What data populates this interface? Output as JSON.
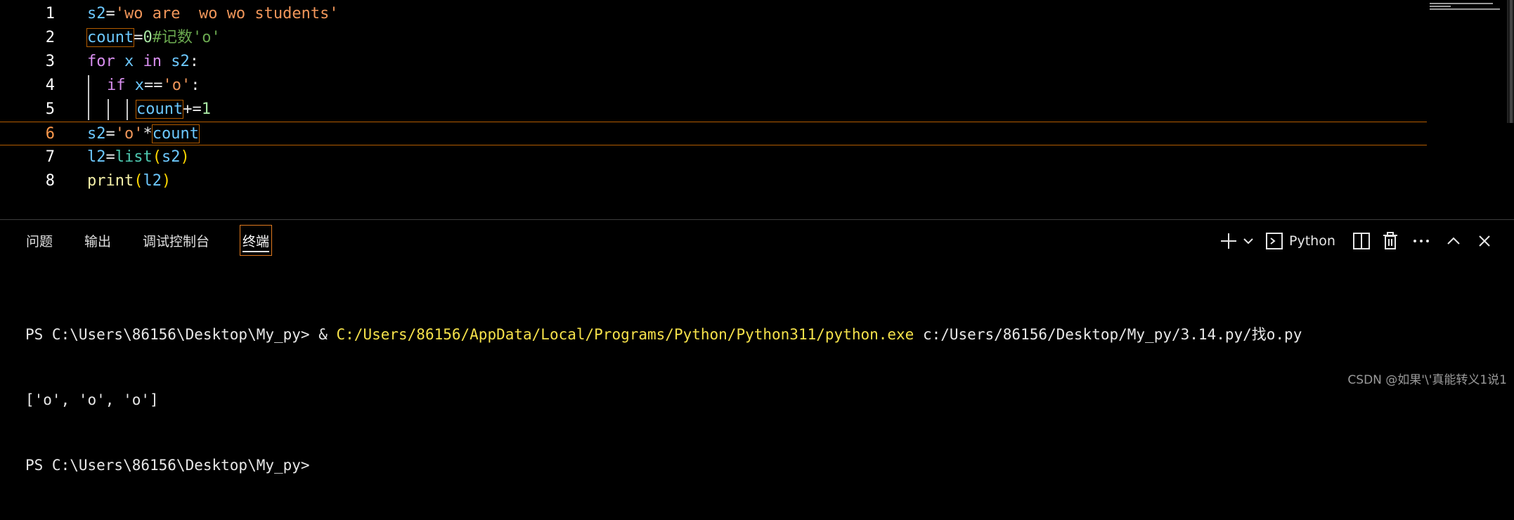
{
  "editor": {
    "lines": [
      {
        "number": "1"
      },
      {
        "number": "2"
      },
      {
        "number": "3"
      },
      {
        "number": "4"
      },
      {
        "number": "5"
      },
      {
        "number": "6"
      },
      {
        "number": "7"
      },
      {
        "number": "8"
      }
    ],
    "tokens": {
      "l1_a": "s2",
      "l1_b": "=",
      "l1_c": "'wo are  wo wo students'",
      "l2_a": "count",
      "l2_b": "=",
      "l2_c": "0",
      "l2_d": "#记数'o'",
      "l3_a": "for",
      "l3_b": " x ",
      "l3_c": "in",
      "l3_d": " s2",
      "l3_e": ":",
      "l4_a": "if",
      "l4_b": " x",
      "l4_c": "==",
      "l4_d": "'o'",
      "l4_e": ":",
      "l5_a": "count",
      "l5_b": "+=",
      "l5_c": "1",
      "l6_a": "s2",
      "l6_b": "=",
      "l6_c": "'o'",
      "l6_d": "*",
      "l6_e": "count",
      "l7_a": "l2",
      "l7_b": "=",
      "l7_c": "list",
      "l7_d": "(",
      "l7_e": "s2",
      "l7_f": ")",
      "l8_a": "print",
      "l8_b": "(",
      "l8_c": "l2",
      "l8_d": ")"
    },
    "active_line": "6"
  },
  "panel": {
    "tabs": [
      {
        "label": "问题"
      },
      {
        "label": "输出"
      },
      {
        "label": "调试控制台"
      },
      {
        "label": "终端"
      }
    ],
    "active_tab": "终端",
    "shell_label": "Python",
    "icons": {
      "add": "plus-icon",
      "dropdown": "chevron-down-icon",
      "shell": "terminal-icon",
      "split": "split-terminal-icon",
      "kill": "trash-icon",
      "more": "ellipsis-icon",
      "maximize": "chevron-up-icon",
      "close": "close-icon"
    }
  },
  "terminal": {
    "line1_prompt": "PS C:\\Users\\86156\\Desktop\\My_py> & ",
    "line1_exe": "C:/Users/86156/AppData/Local/Programs/Python/Python311/python.exe",
    "line1_script": " c:/Users/86156/Desktop/My_py/3.14.py/找o.py",
    "line2_output": "['o', 'o', 'o']",
    "line3_prompt": "PS C:\\Users\\86156\\Desktop\\My_py>"
  },
  "watermark": "CSDN @如果'\\'真能转义1说1",
  "colors": {
    "accent_orange": "#e07a1f",
    "current_line_border": "#b35c00",
    "exe_path": "#f5e14a"
  }
}
